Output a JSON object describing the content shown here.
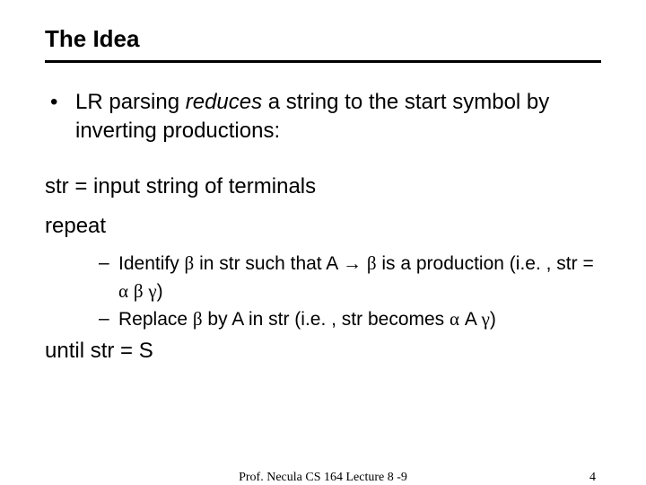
{
  "title": "The Idea",
  "bullet": {
    "pre": "LR parsing ",
    "emph": "reduces",
    "post": " a string to the start symbol by inverting productions:"
  },
  "algo": {
    "line1": "str = input string of terminals",
    "line2": "repeat",
    "sub1a": "Identify ",
    "sub1b": " in str such that A ",
    "sub1c": " is a production (i.e. , str = ",
    "sub1d": ")",
    "sub2a": "Replace ",
    "sub2b": " by A in str (i.e. , str becomes ",
    "sub2c": " A ",
    "sub2d": ")",
    "line3": "until str = S"
  },
  "sym": {
    "alpha": "α",
    "beta": "β",
    "gamma": "γ",
    "arrow": "→"
  },
  "footer": {
    "center": "Prof.  Necula  CS 164  Lecture 8 -9",
    "page": "4"
  }
}
